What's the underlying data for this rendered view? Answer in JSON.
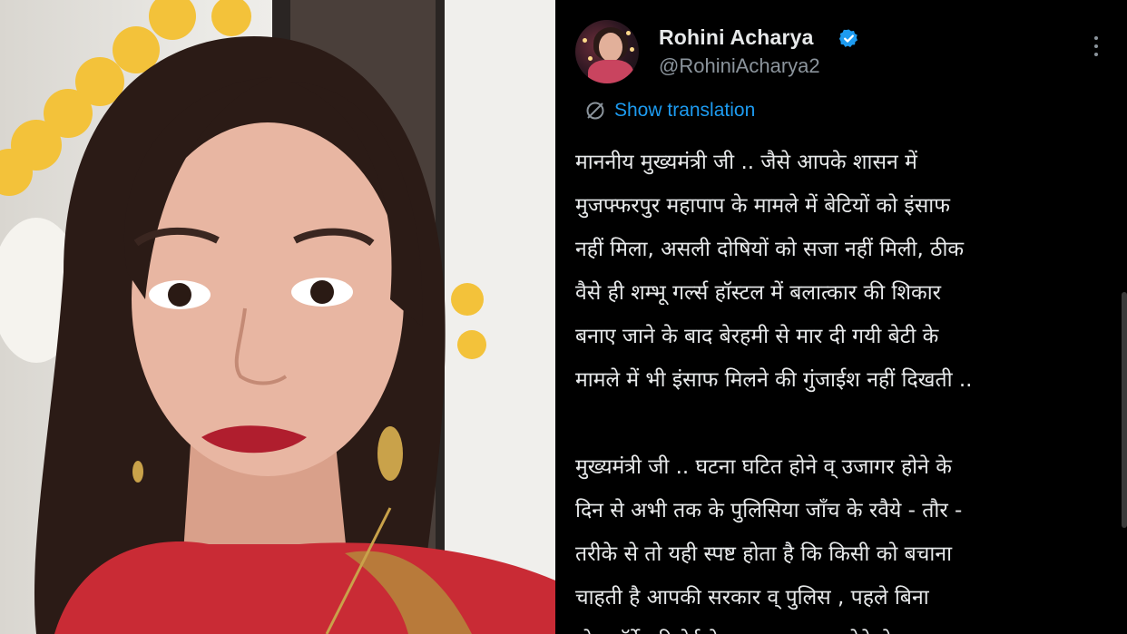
{
  "tweet": {
    "display_name": "Rohini Acharya",
    "handle": "@RohiniAcharya2",
    "verified": true,
    "translate_label": "Show translation",
    "paragraphs": [
      {
        "lines": [
          "माननीय मुख्यमंत्री जी .. जैसे आपके शासन में",
          "मुजफ्फरपुर महापाप के मामले में बेटियों को इंसाफ",
          "नहीं मिला, असली दोषियों को सजा नहीं मिली, ठीक",
          "वैसे ही शम्भू गर्ल्स हॉस्टल में बलात्कार की शिकार",
          "बनाए जाने के बाद बेरहमी से मार दी गयी बेटी के",
          "मामले में भी इंसाफ मिलने की गुंजाईश नहीं दिखती .."
        ]
      },
      {
        "lines": [
          "मुख्यमंत्री जी .. घटना घटित होने व् उजागर होने के",
          "दिन से अभी तक के पुलिसिया जाँच के रवैये - तौर -",
          "तरीके से तो यही स्पष्ट होता है कि किसी को बचाना",
          "चाहती है आपकी सरकार व् पुलिस , पहले बिना",
          "पोस्टमॉर्टेम रिपोर्ट के आए बलात्कार होने से पटना"
        ]
      }
    ]
  },
  "icons": {
    "verified": "verified-badge-icon",
    "more": "more-options-icon",
    "translate": "translate-globe-icon"
  },
  "colors": {
    "background": "#000000",
    "text": "#e7e9ea",
    "secondary_text": "#8b949c",
    "accent": "#1d9bf0"
  }
}
